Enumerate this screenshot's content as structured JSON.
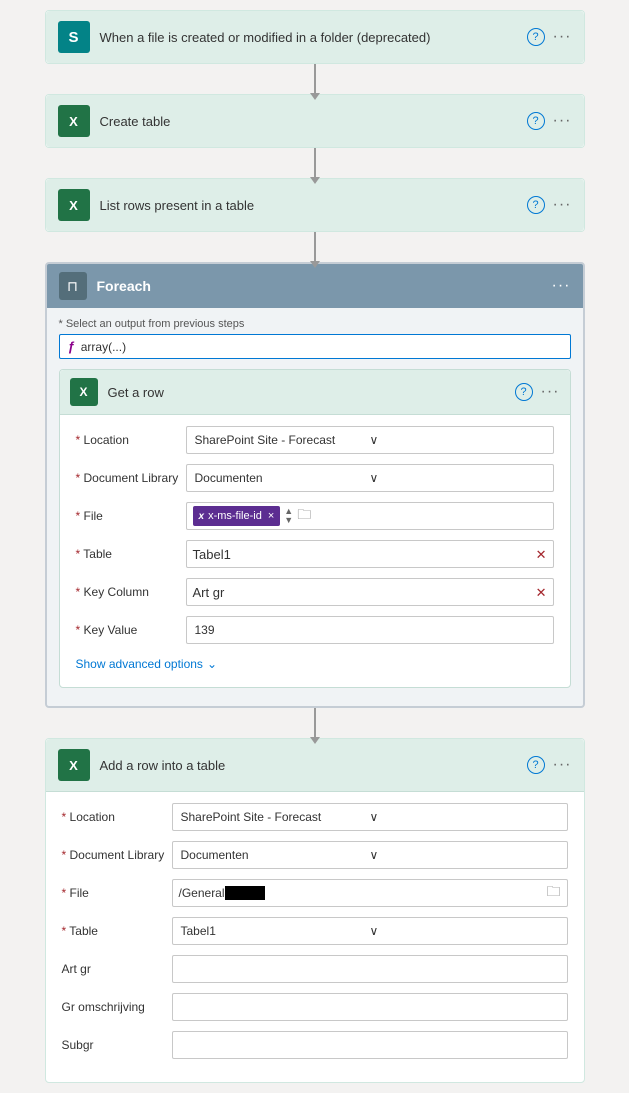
{
  "flow": {
    "step1": {
      "title": "When a file is created or modified in a folder (deprecated)",
      "icon_type": "sharepoint",
      "icon_letter": "S"
    },
    "step2": {
      "title": "Create table",
      "icon_type": "excel",
      "icon_letter": "X"
    },
    "step3": {
      "title": "List rows present in a table",
      "icon_type": "excel",
      "icon_letter": "X"
    },
    "foreach": {
      "title": "Foreach",
      "select_label": "* Select an output from previous steps",
      "select_value": "array(...)"
    },
    "get_row": {
      "title": "Get a row",
      "icon_type": "excel",
      "icon_letter": "X",
      "fields": {
        "location_label": "* Location",
        "location_value": "SharePoint Site - Forecast",
        "doc_library_label": "* Document Library",
        "doc_library_value": "Documenten",
        "file_label": "* File",
        "file_token": "x-ms-file-id",
        "table_label": "* Table",
        "table_value": "Tabel1",
        "key_column_label": "* Key Column",
        "key_column_value": "Art gr",
        "key_value_label": "* Key Value",
        "key_value_value": "139"
      },
      "show_advanced_label": "Show advanced options"
    },
    "add_row": {
      "title": "Add a row into a table",
      "icon_type": "excel",
      "icon_letter": "X",
      "fields": {
        "location_label": "* Location",
        "location_value": "SharePoint Site - Forecast",
        "doc_library_label": "* Document Library",
        "doc_library_value": "Documenten",
        "file_label": "* File",
        "file_value": "/General",
        "file_masked": "████████████",
        "table_label": "* Table",
        "table_value": "Tabel1",
        "art_gr_label": "Art gr",
        "gr_omschrijving_label": "Gr omschrijving",
        "subgr_label": "Subgr"
      }
    }
  },
  "icons": {
    "question_mark": "?",
    "dots": "···",
    "chevron_down": "∨",
    "chevron_down2": "⌄",
    "arrow_down": "↓",
    "func": "ƒ",
    "foreach_symbol": "⊓"
  }
}
